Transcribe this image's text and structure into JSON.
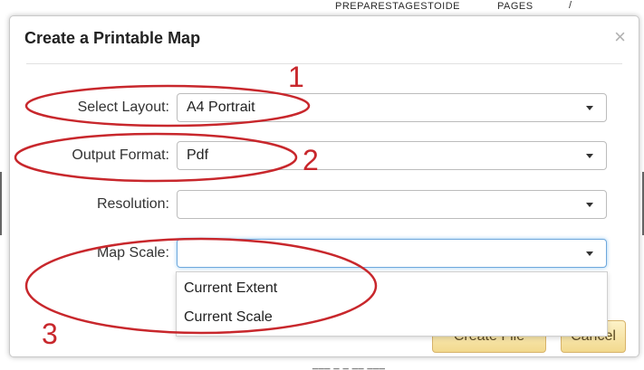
{
  "backdrop": {
    "top_texts": [
      "PREPARESTAGESTOIDE",
      "PAGES",
      "/"
    ],
    "bottom_text": "___ _ _ __ ___"
  },
  "dialog": {
    "title": "Create a Printable Map",
    "close_glyph": "×",
    "fields": {
      "layout": {
        "label": "Select Layout:",
        "value": "A4 Portrait"
      },
      "format": {
        "label": "Output Format:",
        "value": "Pdf"
      },
      "resolution": {
        "label": "Resolution:",
        "value": ""
      },
      "scale": {
        "label": "Map Scale:",
        "value": "",
        "focused": true
      }
    },
    "scale_options": [
      "Current Extent",
      "Current Scale"
    ],
    "buttons": {
      "create": "Create File",
      "cancel": "Cancel"
    }
  },
  "annotations": {
    "color": "#c8272c",
    "numbers": [
      "1",
      "2",
      "3"
    ]
  },
  "colors": {
    "focus_border": "#6fa8dc",
    "button_fill": "#f2d98e",
    "annotation_red": "#c8272c"
  }
}
